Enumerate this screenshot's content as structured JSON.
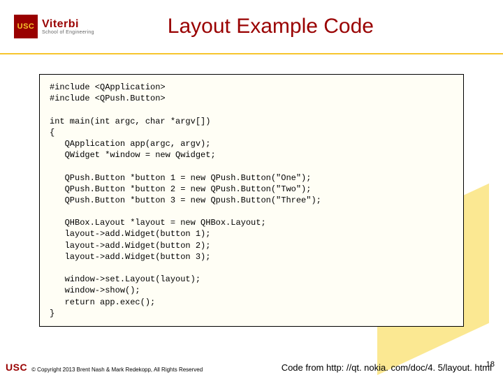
{
  "header": {
    "logo_mark": "USC",
    "logo_name": "Viterbi",
    "logo_sub": "School of Engineering",
    "title": "Layout Example Code"
  },
  "code": "#include <QApplication>\n#include <QPush.Button>\n\nint main(int argc, char *argv[])\n{\n   QApplication app(argc, argv);\n   QWidget *window = new Qwidget;\n\n   QPush.Button *button 1 = new QPush.Button(\"One\");\n   QPush.Button *button 2 = new QPush.Button(\"Two\");\n   QPush.Button *button 3 = new Qpush.Button(\"Three\");\n\n   QHBox.Layout *layout = new QHBox.Layout;\n   layout->add.Widget(button 1);\n   layout->add.Widget(button 2);\n   layout->add.Widget(button 3);\n\n   window->set.Layout(layout);\n   window->show();\n   return app.exec();\n}",
  "footer": {
    "usc": "USC",
    "copyright": "© Copyright 2013 Brent Nash & Mark Redekopp, All Rights Reserved",
    "source": "Code from http: //qt. nokia. com/doc/4. 5/layout. html",
    "page": "18"
  }
}
